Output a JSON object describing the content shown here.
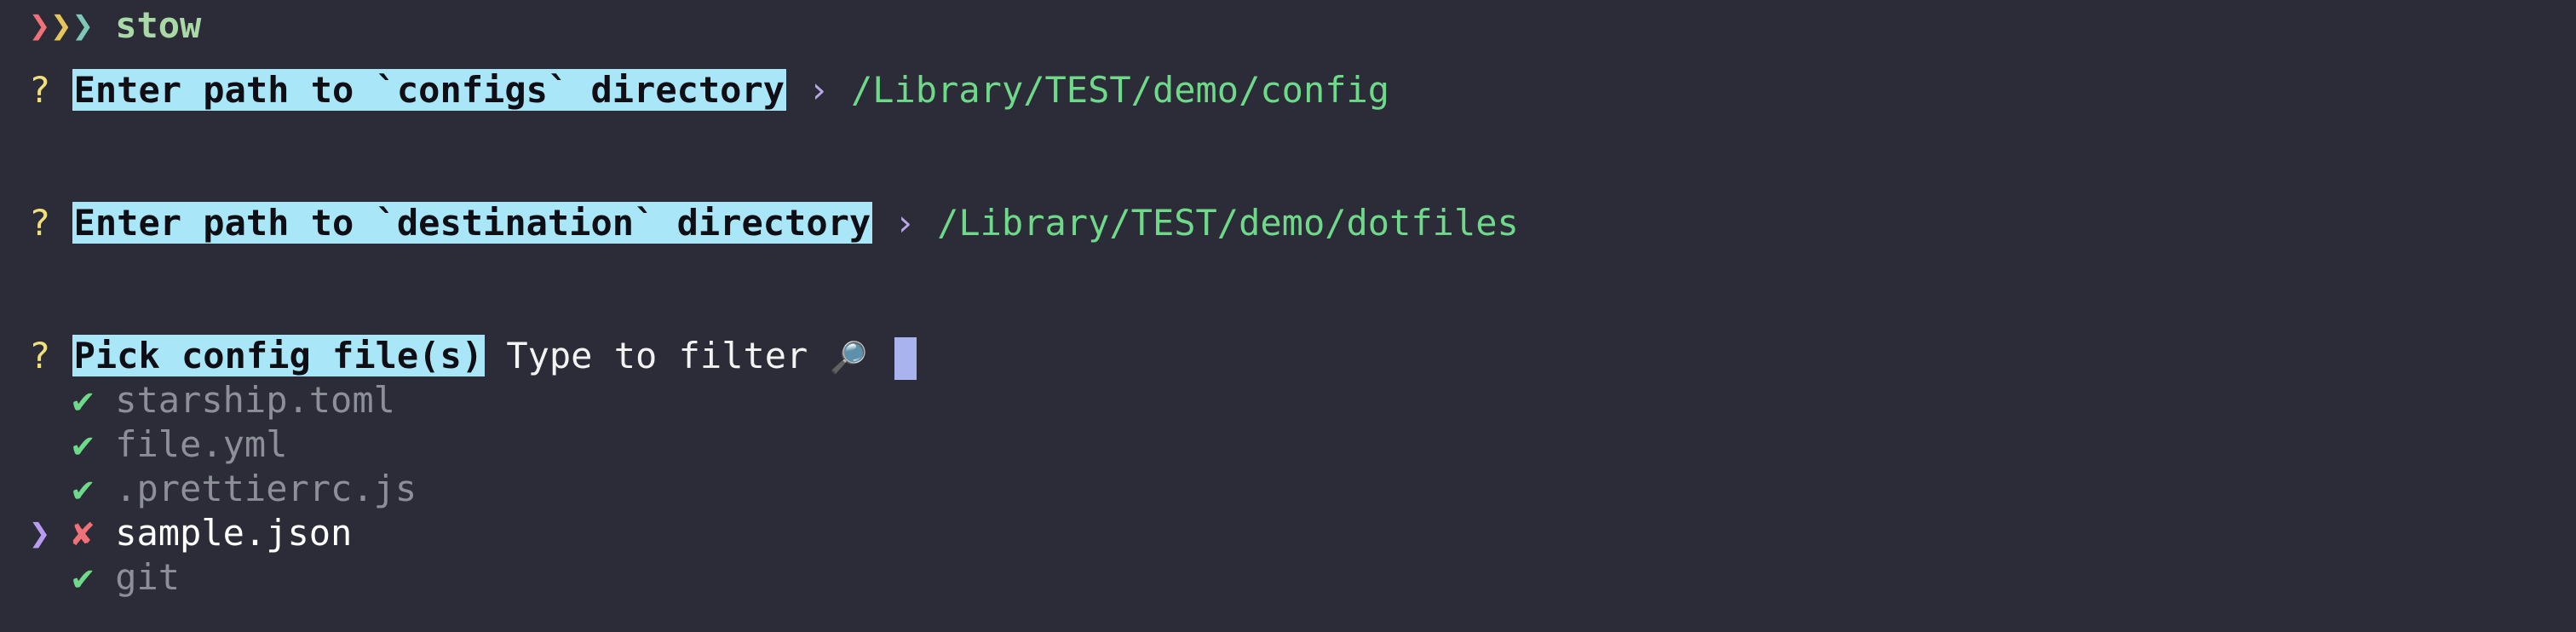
{
  "prompt": {
    "chevrons": [
      "❯",
      "❯",
      "❯"
    ],
    "command": "stow"
  },
  "q1": {
    "mark": "?",
    "question": "Enter path to `configs` directory",
    "arrow": "›",
    "answer": "/Library/TEST/demo/config"
  },
  "q2": {
    "mark": "?",
    "question": "Enter path to `destination` directory",
    "arrow": "›",
    "answer": "/Library/TEST/demo/dotfiles"
  },
  "q3": {
    "mark": "?",
    "question": "Pick config file(s)",
    "filter_placeholder": "Type to filter",
    "filter_icon": "🔎"
  },
  "options": [
    {
      "pointer": "",
      "status": "✔",
      "label": "starship.toml"
    },
    {
      "pointer": "",
      "status": "✔",
      "label": "file.yml"
    },
    {
      "pointer": "",
      "status": "✔",
      "label": ".prettierrc.js"
    },
    {
      "pointer": "❯",
      "status": "✘",
      "label": "sample.json"
    },
    {
      "pointer": "",
      "status": "✔",
      "label": "git"
    }
  ],
  "colors": {
    "background": "#2b2c37",
    "question_highlight": "#a8e6f8",
    "answer": "#6fd98a",
    "cursor": "#a9b3ee"
  }
}
